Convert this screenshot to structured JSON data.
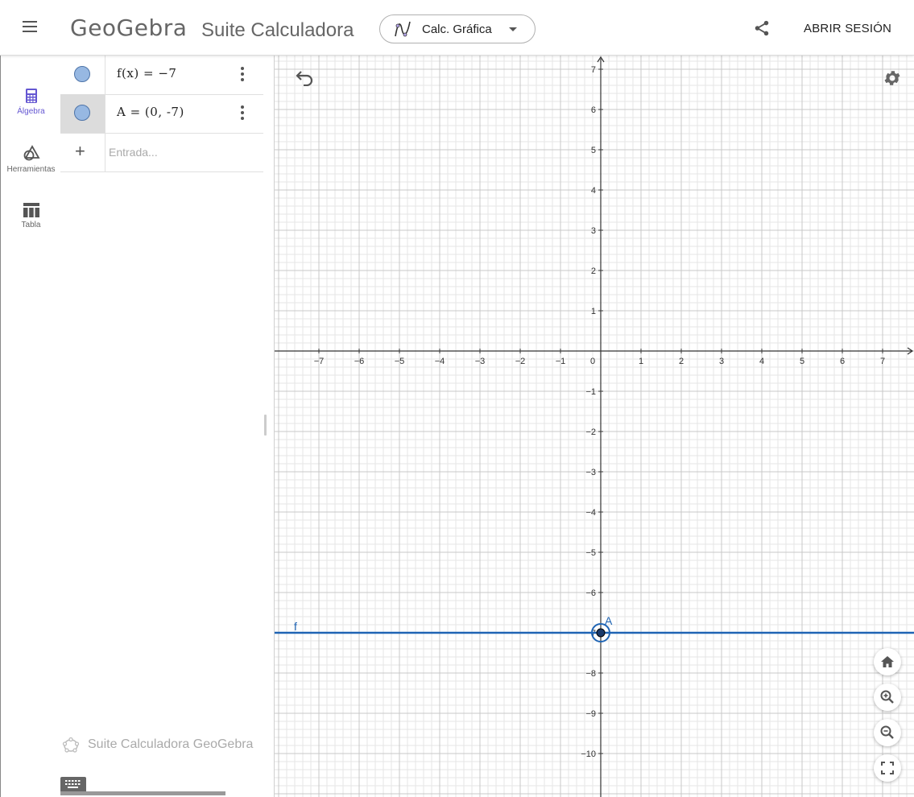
{
  "header": {
    "logo": "GeoGebra",
    "suite_title": "Suite Calculadora",
    "app_picker_label": "Calc. Gráfica",
    "login_label": "ABRIR SESIÓN"
  },
  "sidenav": {
    "items": [
      {
        "label": "Álgebra",
        "icon": "calculator-icon",
        "active": true
      },
      {
        "label": "Herramientas",
        "icon": "shapes-icon",
        "active": false
      },
      {
        "label": "Tabla",
        "icon": "table-icon",
        "active": false
      }
    ]
  },
  "algebra": {
    "rows": [
      {
        "expression": "f(x) = −7",
        "color": "#97b8e2",
        "selected": false
      },
      {
        "expression": "A = (0, -7)",
        "color": "#97b8e2",
        "selected": true
      }
    ],
    "input_placeholder": "Entrada...",
    "footer_brand": "Suite Calculadora GeoGebra"
  },
  "graphics": {
    "x_ticks": [
      "−7",
      "−6",
      "−5",
      "−4",
      "−3",
      "−2",
      "−1",
      "0",
      "1",
      "2",
      "3",
      "4",
      "5",
      "6",
      "7"
    ],
    "y_ticks": [
      "7",
      "6",
      "5",
      "4",
      "3",
      "2",
      "1",
      "−1",
      "−2",
      "−3",
      "−4",
      "−5",
      "−6",
      "−7",
      "−8",
      "−9",
      "−10"
    ],
    "function_label": "f",
    "point_label": "A",
    "line_color": "#1f64b4",
    "point_value": [
      0,
      -7
    ],
    "function_value": -7
  }
}
